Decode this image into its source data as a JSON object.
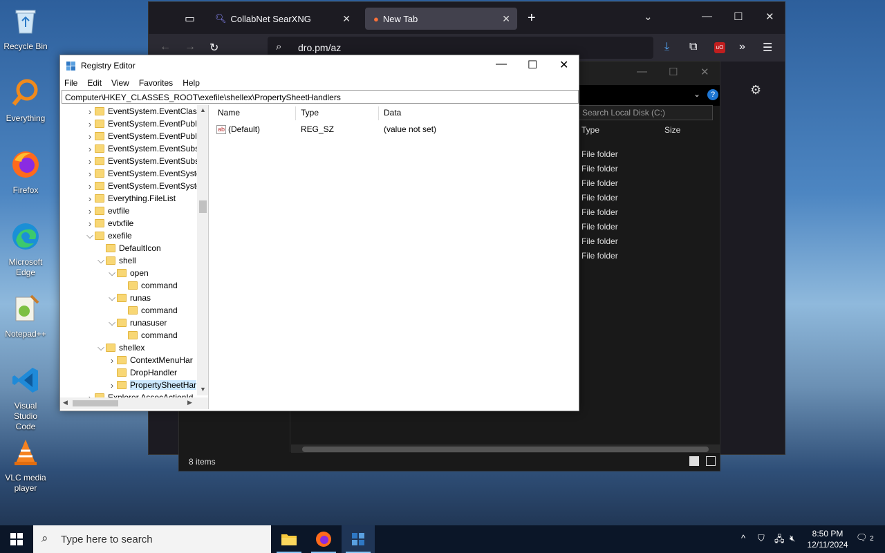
{
  "desktop": {
    "icons": [
      {
        "label": "Recycle Bin"
      },
      {
        "label": "Everything"
      },
      {
        "label": "Firefox"
      },
      {
        "label": "Microsoft Edge"
      },
      {
        "label": "Notepad++"
      },
      {
        "label": "Visual Studio Code"
      },
      {
        "label": "VLC media player"
      }
    ]
  },
  "browser": {
    "tabs": [
      {
        "title": "CollabNet SearXNG"
      },
      {
        "title": "New Tab"
      }
    ],
    "url": "dro.pm/az",
    "add_tab": "+"
  },
  "explorer": {
    "search_placeholder": "Search Local Disk (C:)",
    "columns": {
      "type": "Type",
      "size": "Size"
    },
    "rows": [
      "File folder",
      "File folder",
      "File folder",
      "File folder",
      "File folder",
      "File folder",
      "File folder",
      "File folder"
    ],
    "status": "8 items"
  },
  "regedit": {
    "title": "Registry Editor",
    "menu": [
      "File",
      "Edit",
      "View",
      "Favorites",
      "Help"
    ],
    "address": "Computer\\HKEY_CLASSES_ROOT\\exefile\\shellex\\PropertySheetHandlers",
    "tree": [
      {
        "label": "EventSystem.EventClass",
        "indent": 0,
        "chev": ">"
      },
      {
        "label": "EventSystem.EventPubl",
        "indent": 0,
        "chev": ">"
      },
      {
        "label": "EventSystem.EventPubl",
        "indent": 0,
        "chev": ">"
      },
      {
        "label": "EventSystem.EventSubs",
        "indent": 0,
        "chev": ">"
      },
      {
        "label": "EventSystem.EventSubs",
        "indent": 0,
        "chev": ">"
      },
      {
        "label": "EventSystem.EventSyste",
        "indent": 0,
        "chev": ">"
      },
      {
        "label": "EventSystem.EventSyste",
        "indent": 0,
        "chev": ">"
      },
      {
        "label": "Everything.FileList",
        "indent": 0,
        "chev": ">"
      },
      {
        "label": "evtfile",
        "indent": 0,
        "chev": ">"
      },
      {
        "label": "evtxfile",
        "indent": 0,
        "chev": ">"
      },
      {
        "label": "exefile",
        "indent": 0,
        "chev": "v"
      },
      {
        "label": "DefaultIcon",
        "indent": 1,
        "chev": ""
      },
      {
        "label": "shell",
        "indent": 1,
        "chev": "v"
      },
      {
        "label": "open",
        "indent": 2,
        "chev": "v"
      },
      {
        "label": "command",
        "indent": 3,
        "chev": ""
      },
      {
        "label": "runas",
        "indent": 2,
        "chev": "v"
      },
      {
        "label": "command",
        "indent": 3,
        "chev": ""
      },
      {
        "label": "runasuser",
        "indent": 2,
        "chev": "v"
      },
      {
        "label": "command",
        "indent": 3,
        "chev": ""
      },
      {
        "label": "shellex",
        "indent": 1,
        "chev": "v"
      },
      {
        "label": "ContextMenuHar",
        "indent": 2,
        "chev": ">"
      },
      {
        "label": "DropHandler",
        "indent": 2,
        "chev": ""
      },
      {
        "label": "PropertySheetHar",
        "indent": 2,
        "chev": ">",
        "selected": true
      },
      {
        "label": "Explorer.AssocActionId",
        "indent": 0,
        "chev": ">"
      }
    ],
    "columns": {
      "name": "Name",
      "type": "Type",
      "data": "Data"
    },
    "values": [
      {
        "name": "(Default)",
        "type": "REG_SZ",
        "data": "(value not set)"
      }
    ]
  },
  "taskbar": {
    "search_placeholder": "Type here to search",
    "time": "8:50 PM",
    "date": "12/11/2024",
    "notifications": "2"
  }
}
